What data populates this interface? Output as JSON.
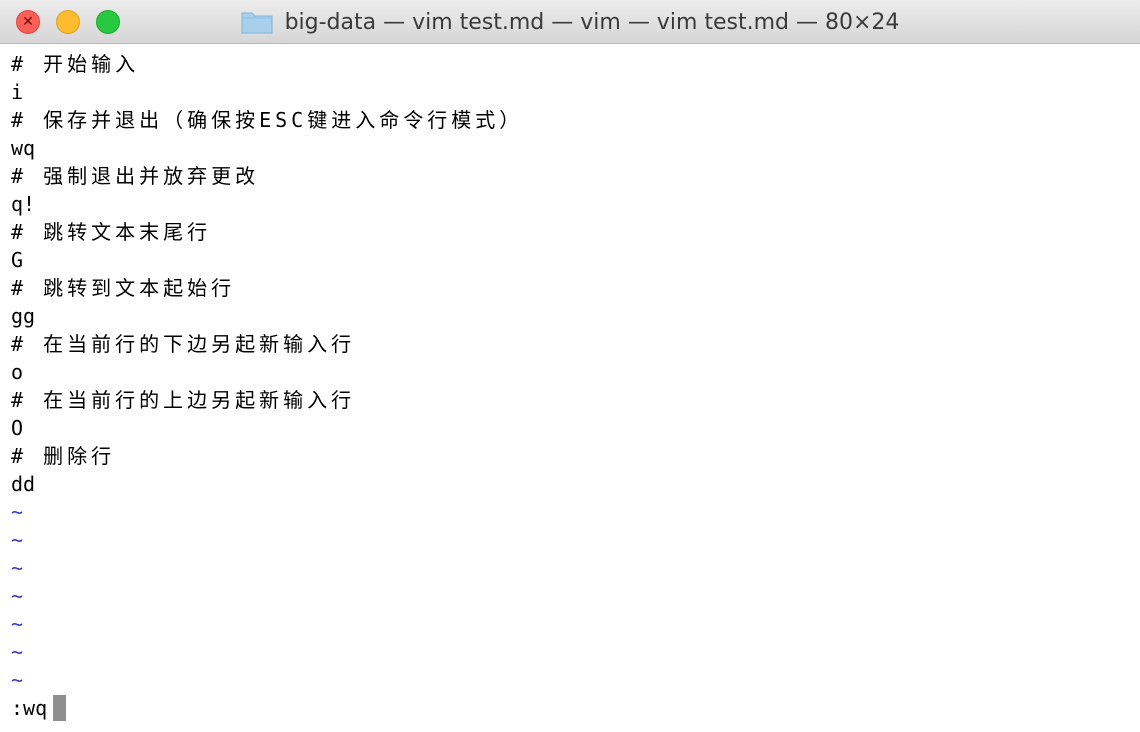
{
  "window": {
    "title": "big-data — vim test.md — vim — vim test.md — 80×24",
    "folder_icon": "folder-icon",
    "close_glyph": "✕"
  },
  "editor": {
    "lines": [
      "# 开始输入",
      "i",
      "# 保存并退出（确保按ESC键进入命令行模式）",
      "wq",
      "# 强制退出并放弃更改",
      "q!",
      "# 跳转文本末尾行",
      "G",
      "# 跳转到文本起始行",
      "gg",
      "# 在当前行的下边另起新输入行",
      "o",
      "# 在当前行的上边另起新输入行",
      "O",
      "# 删除行",
      "dd"
    ],
    "tilde": "~",
    "command_line": ":wq"
  },
  "colors": {
    "tilde": "#3b38c8",
    "cursor": "#8f8f8f"
  }
}
